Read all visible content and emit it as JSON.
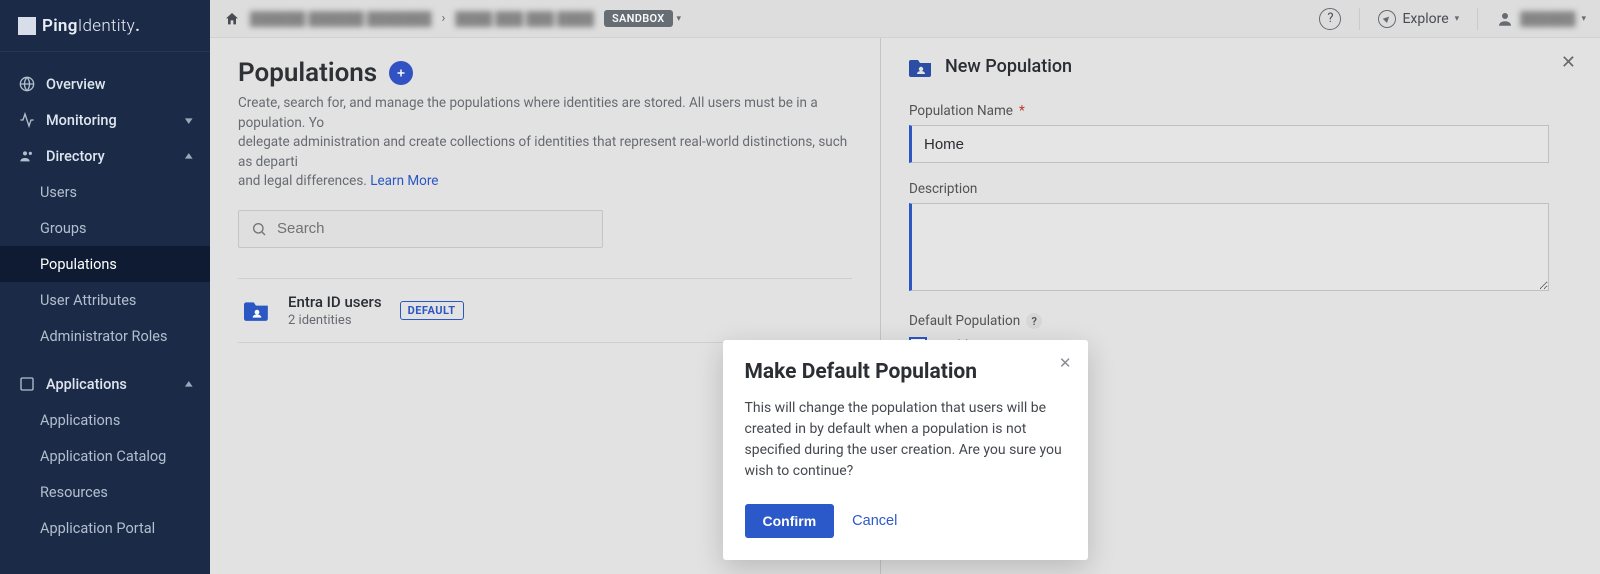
{
  "brand": {
    "name_a": "Ping",
    "name_b": "Identity"
  },
  "topbar": {
    "sandbox_badge": "SANDBOX",
    "explore_label": "Explore"
  },
  "sidebar": {
    "items": [
      {
        "label": "Overview",
        "icon": "globe",
        "type": "section"
      },
      {
        "label": "Monitoring",
        "icon": "activity",
        "type": "section",
        "expandable": true
      },
      {
        "label": "Directory",
        "icon": "users",
        "type": "section",
        "expanded": true
      },
      {
        "label": "Users"
      },
      {
        "label": "Groups"
      },
      {
        "label": "Populations",
        "active": true
      },
      {
        "label": "User Attributes"
      },
      {
        "label": "Administrator Roles"
      },
      {
        "label": "Applications",
        "icon": "apps",
        "type": "section",
        "expanded": true
      },
      {
        "label": "Applications"
      },
      {
        "label": "Application Catalog"
      },
      {
        "label": "Resources"
      },
      {
        "label": "Application Portal"
      }
    ]
  },
  "page": {
    "title": "Populations",
    "description_a": "Create, search for, and manage the populations where identities are stored. All users must be in a population. Yo",
    "description_b": "delegate administration and create collections of identities that represent real-world distinctions, such as departi",
    "description_c": "and legal differences. ",
    "learn_more": "Learn More",
    "search_placeholder": "Search",
    "rows": [
      {
        "name": "Entra ID users",
        "sub": "2 identities",
        "default": true
      }
    ],
    "default_badge_label": "DEFAULT"
  },
  "panel": {
    "title": "New Population",
    "name_label": "Population Name",
    "name_value": "Home",
    "description_label": "Description",
    "description_value": "",
    "default_pop_label": "Default Population",
    "enable_label": "Enable"
  },
  "modal": {
    "title": "Make Default Population",
    "body": "This will change the population that users will be created in by default when a population is not specified during the user creation. Are you sure you wish to continue?",
    "confirm": "Confirm",
    "cancel": "Cancel"
  }
}
